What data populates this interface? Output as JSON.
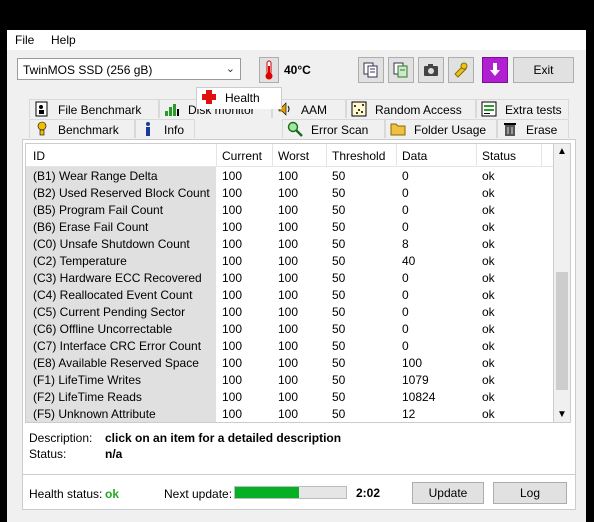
{
  "menu": {
    "file": "File",
    "help": "Help"
  },
  "drive": {
    "selected": "TwinMOS SSD (256 gB)"
  },
  "temperature": "40°C",
  "toolbar": {
    "exit_label": "Exit"
  },
  "tabs_row1": [
    {
      "label": "File Benchmark",
      "icon": "file-benchmark-icon"
    },
    {
      "label": "Disk monitor",
      "icon": "disk-monitor-icon"
    },
    {
      "label": "AAM",
      "icon": "speaker-icon"
    },
    {
      "label": "Random Access",
      "icon": "random-access-icon"
    },
    {
      "label": "Extra tests",
      "icon": "extra-tests-icon"
    }
  ],
  "tabs_row2": [
    {
      "label": "Benchmark",
      "icon": "benchmark-icon"
    },
    {
      "label": "Info",
      "icon": "info-icon"
    },
    {
      "label": "Health",
      "icon": "health-cross-icon"
    },
    {
      "label": "Error Scan",
      "icon": "magnifier-icon"
    },
    {
      "label": "Folder Usage",
      "icon": "folder-icon"
    },
    {
      "label": "Erase",
      "icon": "trash-icon"
    }
  ],
  "table": {
    "columns": [
      "ID",
      "Current",
      "Worst",
      "Threshold",
      "Data",
      "Status"
    ],
    "rows": [
      [
        "(B1) Wear Range Delta",
        "100",
        "100",
        "50",
        "0",
        "ok"
      ],
      [
        "(B2) Used Reserved Block Count",
        "100",
        "100",
        "50",
        "0",
        "ok"
      ],
      [
        "(B5) Program Fail Count",
        "100",
        "100",
        "50",
        "0",
        "ok"
      ],
      [
        "(B6) Erase Fail Count",
        "100",
        "100",
        "50",
        "0",
        "ok"
      ],
      [
        "(C0) Unsafe Shutdown Count",
        "100",
        "100",
        "50",
        "8",
        "ok"
      ],
      [
        "(C2) Temperature",
        "100",
        "100",
        "50",
        "40",
        "ok"
      ],
      [
        "(C3) Hardware ECC Recovered",
        "100",
        "100",
        "50",
        "0",
        "ok"
      ],
      [
        "(C4) Reallocated Event Count",
        "100",
        "100",
        "50",
        "0",
        "ok"
      ],
      [
        "(C5) Current Pending Sector",
        "100",
        "100",
        "50",
        "0",
        "ok"
      ],
      [
        "(C6) Offline Uncorrectable",
        "100",
        "100",
        "50",
        "0",
        "ok"
      ],
      [
        "(C7) Interface CRC Error Count",
        "100",
        "100",
        "50",
        "0",
        "ok"
      ],
      [
        "(E8) Available Reserved Space",
        "100",
        "100",
        "50",
        "100",
        "ok"
      ],
      [
        "(F1) LifeTime Writes",
        "100",
        "100",
        "50",
        "1079",
        "ok"
      ],
      [
        "(F2) LifeTime Reads",
        "100",
        "100",
        "50",
        "10824",
        "ok"
      ],
      [
        "(F5) Unknown Attribute",
        "100",
        "100",
        "50",
        "12",
        "ok"
      ]
    ]
  },
  "description": {
    "label": "Description:",
    "value": "click on an item for a detailed description"
  },
  "status": {
    "label": "Status:",
    "value": "n/a"
  },
  "footer": {
    "health_label": "Health status:",
    "health_value": "ok",
    "next_update_label": "Next update:",
    "progress_fraction": 0.58,
    "timer": "2:02",
    "update_label": "Update",
    "log_label": "Log"
  },
  "colors": {
    "health_ok": "#22aa22",
    "progress": "#06b025",
    "id_column_bg": "#e0e0e0"
  }
}
